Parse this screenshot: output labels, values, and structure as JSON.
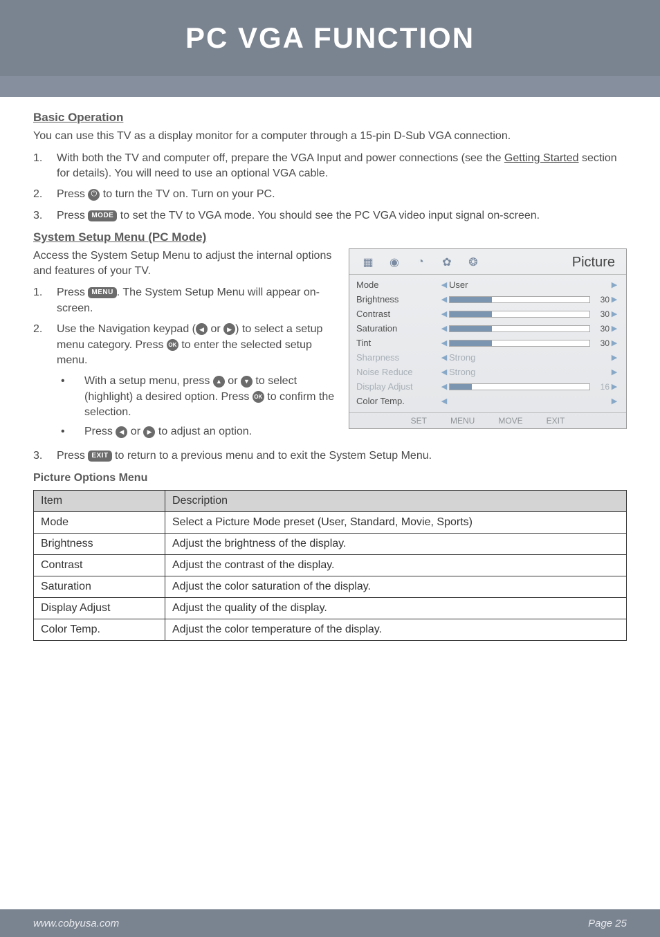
{
  "header": {
    "title": "PC VGA FUNCTION"
  },
  "sections": {
    "basic": {
      "heading": "Basic Operation",
      "intro": "You can use this TV as a display monitor for a computer through a 15-pin D-Sub VGA connection.",
      "step1_a": "With both the TV and computer off, prepare the VGA Input and power connections (see the ",
      "step1_link": "Getting Started",
      "step1_b": " section for details). You will need to use an optional VGA cable.",
      "step2_a": "Press ",
      "step2_b": " to turn the TV on. Turn on your PC.",
      "step3_a": "Press ",
      "step3_b": " to set the TV to VGA mode. You should see the PC VGA video input signal on-screen."
    },
    "system": {
      "heading": "System Setup Menu (PC Mode)",
      "intro": "Access the System Setup Menu to adjust the internal options and features of your TV.",
      "step1_a": "Press ",
      "step1_b": ". The System Setup Menu will appear on-screen.",
      "step2_a": "Use the Navigation keypad (",
      "step2_b": " or ",
      "step2_c": ") to select a setup menu category. Press ",
      "step2_d": " to enter the selected setup menu.",
      "sub1_a": "With a setup menu, press ",
      "sub1_b": " or ",
      "sub1_c": " to select (highlight) a desired option. Press ",
      "sub1_d": " to confirm the selection.",
      "sub2_a": "Press ",
      "sub2_b": " or ",
      "sub2_c": " to adjust an option.",
      "step3_a": "Press ",
      "step3_b": " to return to a previous menu and to exit the System Setup Menu."
    }
  },
  "icons": {
    "power": "⏻",
    "mode": "MODE",
    "menu": "MENU",
    "exit": "EXIT",
    "ok": "OK",
    "left": "◀",
    "right": "▶",
    "up": "▲",
    "down": "▼"
  },
  "osd": {
    "title": "Picture",
    "rows": [
      {
        "label": "Mode",
        "text": "User",
        "dim": false
      },
      {
        "label": "Brightness",
        "slider": 30,
        "dim": false
      },
      {
        "label": "Contrast",
        "slider": 30,
        "dim": false
      },
      {
        "label": "Saturation",
        "slider": 30,
        "dim": false
      },
      {
        "label": "Tint",
        "slider": 30,
        "dim": false
      },
      {
        "label": "Sharpness",
        "text": "Strong",
        "dim": true
      },
      {
        "label": "Noise Reduce",
        "text": "Strong",
        "dim": true
      },
      {
        "label": "Display Adjust",
        "slider": 16,
        "dim": true
      },
      {
        "label": "Color Temp.",
        "text": "",
        "dim": false
      }
    ],
    "footer": {
      "set": "SET",
      "menu": "MENU",
      "move": "MOVE",
      "exit": "EXIT"
    }
  },
  "table": {
    "heading": "Picture Options Menu",
    "header_item": "Item",
    "header_desc": "Description",
    "rows": [
      {
        "item": "Mode",
        "desc": "Select a Picture Mode preset (User, Standard, Movie, Sports)"
      },
      {
        "item": "Brightness",
        "desc": "Adjust the brightness of the display."
      },
      {
        "item": "Contrast",
        "desc": "Adjust the contrast of the display."
      },
      {
        "item": "Saturation",
        "desc": "Adjust the color saturation of the display."
      },
      {
        "item": "Display Adjust",
        "desc": "Adjust the quality of the display."
      },
      {
        "item": "Color Temp.",
        "desc": "Adjust the color temperature of the display."
      }
    ]
  },
  "footer": {
    "url": "www.cobyusa.com",
    "page": "Page 25"
  }
}
